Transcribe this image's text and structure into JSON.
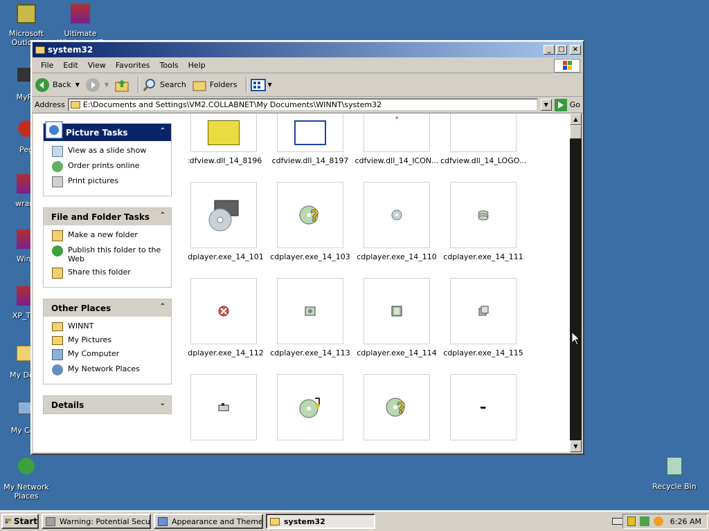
{
  "desktop": {
    "icons": [
      {
        "label": "Microsoft Outlook"
      },
      {
        "label": "Ultimate Windows XP"
      },
      {
        "label": "MyPa"
      },
      {
        "label": "Peg"
      },
      {
        "label": "wrarS"
      },
      {
        "label": "WinR"
      },
      {
        "label": "XP_The"
      },
      {
        "label": "My Docu"
      },
      {
        "label": "My Com"
      },
      {
        "label": "My Network Places"
      },
      {
        "label": "Recycle Bin"
      }
    ]
  },
  "window": {
    "title": "system32",
    "menu": [
      "File",
      "Edit",
      "View",
      "Favorites",
      "Tools",
      "Help"
    ],
    "toolbar": {
      "back": "Back",
      "search": "Search",
      "folders": "Folders"
    },
    "address": {
      "label": "Address",
      "value": "E:\\Documents and Settings\\VM2.COLLABNET\\My Documents\\WINNT\\system32",
      "go": "Go"
    }
  },
  "sidebar": {
    "picture_tasks": {
      "title": "Picture Tasks",
      "items": [
        "View as a slide show",
        "Order prints online",
        "Print pictures"
      ]
    },
    "file_folder_tasks": {
      "title": "File and Folder Tasks",
      "items": [
        "Make a new folder",
        "Publish this folder to the Web",
        "Share this folder"
      ]
    },
    "other_places": {
      "title": "Other Places",
      "items": [
        "WINNT",
        "My Pictures",
        "My Computer",
        "My Network Places"
      ]
    },
    "details": {
      "title": "Details"
    }
  },
  "files": [
    {
      "name": "cdfview.dll_14_8196"
    },
    {
      "name": "cdfview.dll_14_8197"
    },
    {
      "name": "cdfview.dll_14_ICON..."
    },
    {
      "name": "cdfview.dll_14_LOGO..."
    },
    {
      "name": "cdplayer.exe_14_101"
    },
    {
      "name": "cdplayer.exe_14_103"
    },
    {
      "name": "cdplayer.exe_14_110"
    },
    {
      "name": "cdplayer.exe_14_111"
    },
    {
      "name": "cdplayer.exe_14_112"
    },
    {
      "name": "cdplayer.exe_14_113"
    },
    {
      "name": "cdplayer.exe_14_114"
    },
    {
      "name": "cdplayer.exe_14_115"
    },
    {
      "name": ""
    },
    {
      "name": ""
    },
    {
      "name": ""
    },
    {
      "name": ""
    }
  ],
  "taskbar": {
    "start": "Start",
    "tasks": [
      "Warning: Potential Secur...",
      "Appearance and Themes",
      "system32"
    ],
    "clock": "6:26 AM"
  }
}
